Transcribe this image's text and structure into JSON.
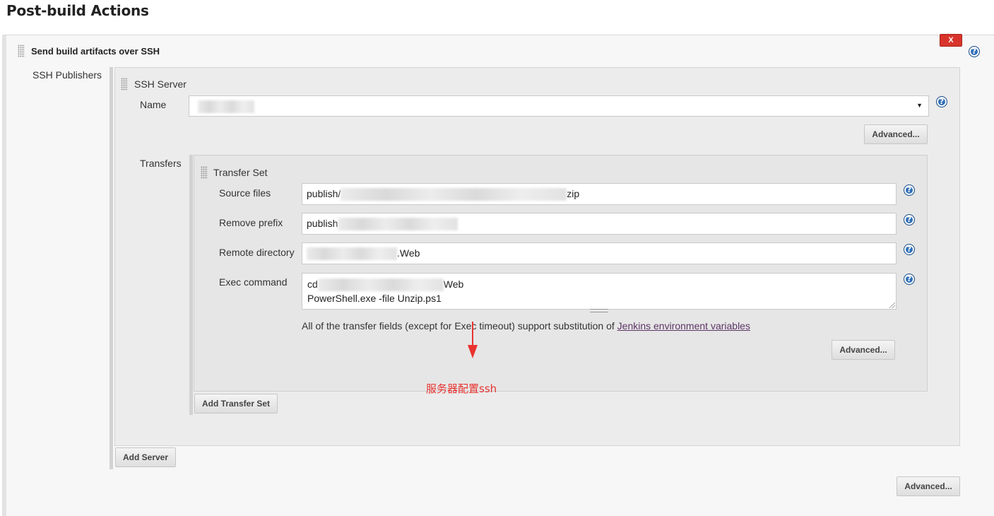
{
  "page": {
    "title": "Post-build Actions"
  },
  "publisher": {
    "title": "Send build artifacts over SSH",
    "delete_label": "X",
    "section_label": "SSH Publishers",
    "advanced_label": "Advanced..."
  },
  "ssh_server": {
    "title": "SSH Server",
    "name_label": "Name",
    "name_value": "",
    "advanced_label": "Advanced...",
    "transfers_label": "Transfers",
    "add_server_label": "Add Server"
  },
  "transfer_set": {
    "title": "Transfer Set",
    "source_files_label": "Source files",
    "source_files_prefix": "publish/",
    "source_files_suffix": "zip",
    "remove_prefix_label": "Remove prefix",
    "remove_prefix_value": "publish",
    "remote_directory_label": "Remote directory",
    "remote_directory_suffix": ".Web",
    "exec_command_label": "Exec command",
    "exec_line1_prefix": "cd",
    "exec_line1_suffix": "Web",
    "exec_line2": "PowerShell.exe -file Unzip.ps1",
    "env_note_pre": "All of the transfer fields (except for Exec timeout) support substitution of ",
    "env_link": "Jenkins environment variables",
    "advanced_label": "Advanced...",
    "add_transfer_label": "Add Transfer Set"
  },
  "annotation": {
    "text": "服务器配置ssh",
    "color": "#e8332f"
  },
  "help": {
    "symbol": "?"
  }
}
